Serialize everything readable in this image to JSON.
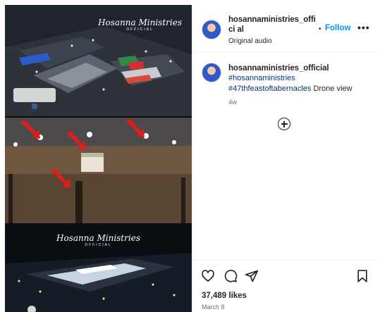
{
  "post": {
    "username": "hosannaministries_official",
    "username_display": "hosannaministries_offici al",
    "audio": "Original audio",
    "separator": "•",
    "follow_label": "Follow",
    "more_label": "•••",
    "caption": {
      "hashtag1": "#hosannaministries",
      "hashtag2": "#47thfeastoftabernacles",
      "text": " Drone view"
    },
    "time_ago": "4w",
    "likes": "37,489 likes",
    "date": "March 8"
  },
  "media": {
    "watermark_1": "Hosanna Ministries",
    "watermark_1_sub": "OFFICIAL",
    "watermark_2": "Hosanna Ministries",
    "watermark_2_sub": "OFFICIAL"
  },
  "icons": {
    "heart": "heart-icon",
    "comment": "comment-icon",
    "share": "share-icon",
    "save": "bookmark-icon",
    "more": "more-options-icon",
    "add": "plus-circle-icon"
  },
  "colors": {
    "follow": "#0095f6",
    "hashtag": "#00376b",
    "arrow": "#e31b1b"
  }
}
